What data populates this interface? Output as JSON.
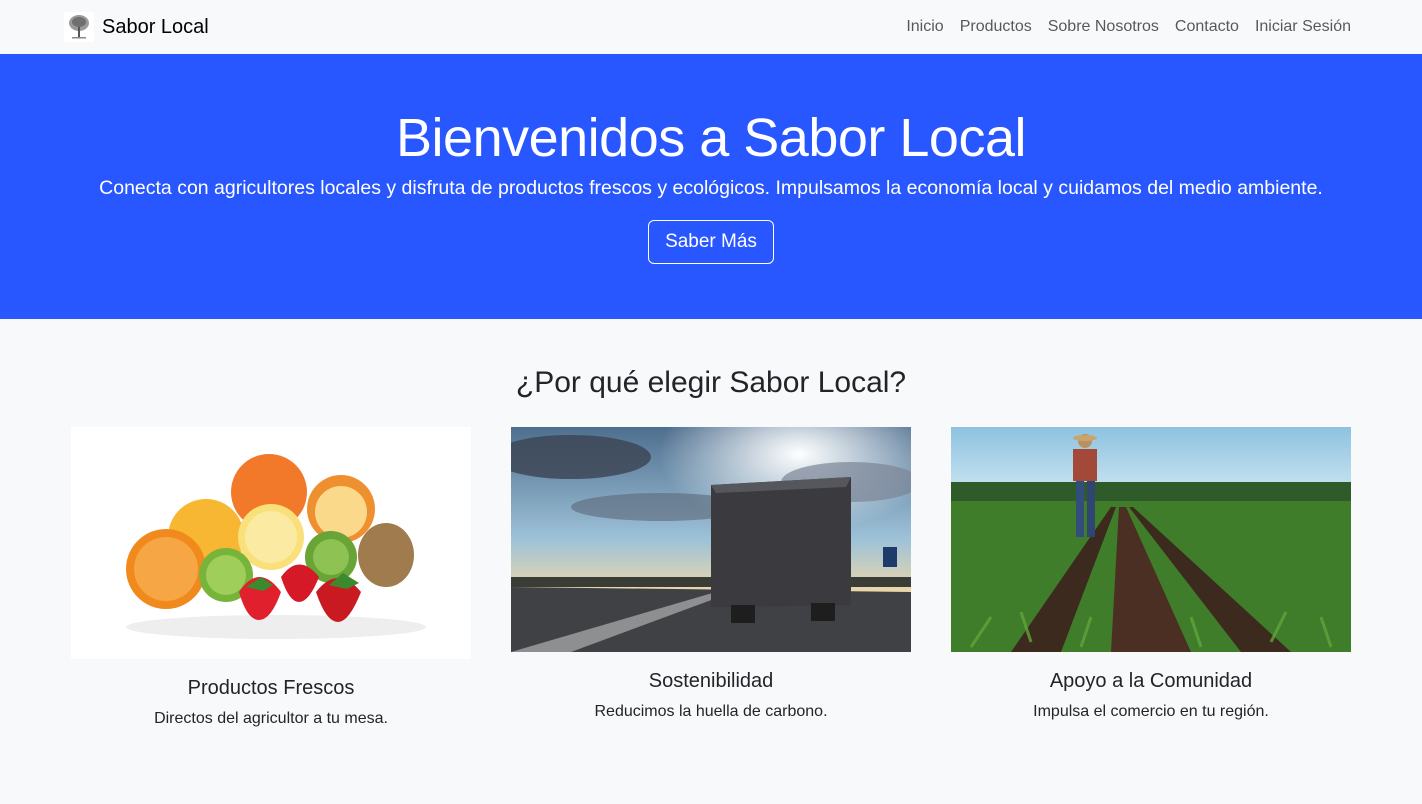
{
  "brand": {
    "name": "Sabor Local",
    "logo_icon": "tree-icon"
  },
  "nav": [
    {
      "label": "Inicio"
    },
    {
      "label": "Productos"
    },
    {
      "label": "Sobre Nosotros"
    },
    {
      "label": "Contacto"
    },
    {
      "label": "Iniciar Sesión"
    }
  ],
  "hero": {
    "title": "Bienvenidos a Sabor Local",
    "text": "Conecta con agricultores locales y disfruta de productos frescos y ecológicos. Impulsamos la economía local y cuidamos del medio ambiente.",
    "button": "Saber Más",
    "background": "#2957ff"
  },
  "features": {
    "title": "¿Por qué elegir Sabor Local?",
    "cards": [
      {
        "title": "Productos Frescos",
        "text": "Directos del agricultor a tu mesa.",
        "image": "fresh-fruit-image"
      },
      {
        "title": "Sostenibilidad",
        "text": "Reducimos la huella de carbono.",
        "image": "truck-on-road-image"
      },
      {
        "title": "Apoyo a la Comunidad",
        "text": "Impulsa el comercio en tu región.",
        "image": "farmer-in-field-image"
      }
    ]
  }
}
